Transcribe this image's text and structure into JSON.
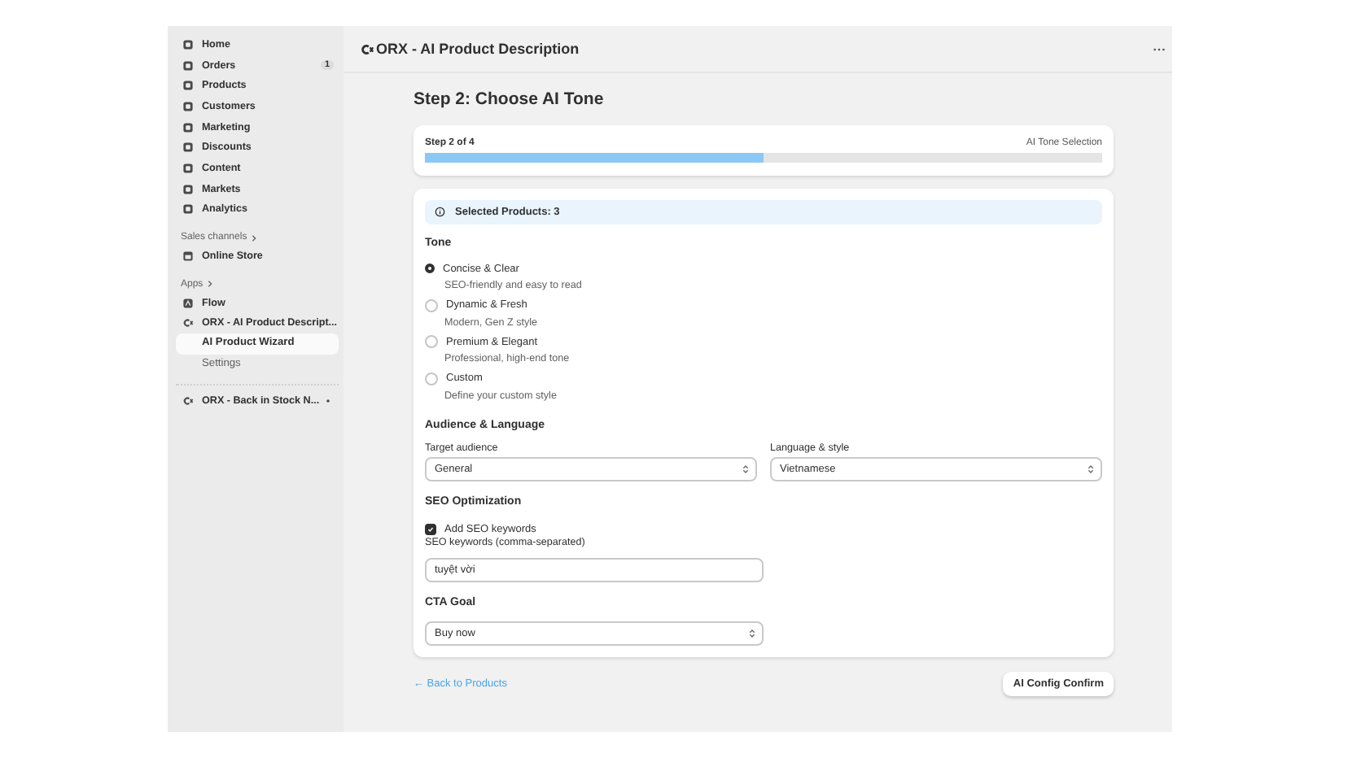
{
  "sidebar": {
    "nav": [
      {
        "label": "Home"
      },
      {
        "label": "Orders",
        "badge": "1"
      },
      {
        "label": "Products"
      },
      {
        "label": "Customers"
      },
      {
        "label": "Marketing"
      },
      {
        "label": "Discounts"
      },
      {
        "label": "Content"
      },
      {
        "label": "Markets"
      },
      {
        "label": "Analytics"
      }
    ],
    "sales_channels": {
      "heading": "Sales channels",
      "items": [
        {
          "label": "Online Store"
        }
      ]
    },
    "apps": {
      "heading": "Apps",
      "items": [
        {
          "label": "Flow"
        },
        {
          "label": "ORX - AI Product Descript...",
          "children": [
            {
              "label": "AI Product Wizard",
              "selected": true
            },
            {
              "label": "Settings",
              "selected": false
            }
          ]
        }
      ]
    },
    "pinned": [
      {
        "label": "ORX - Back in Stock N..."
      }
    ]
  },
  "header": {
    "title": "ORX - AI Product Description"
  },
  "page": {
    "heading": "Step 2: Choose AI Tone",
    "progress": {
      "step": "Step 2 of 4",
      "label": "AI Tone Selection",
      "level": 0.5
    },
    "banner": "Selected Products: 3",
    "tone": {
      "heading": "Tone",
      "options": [
        {
          "label": "Concise & Clear",
          "description": "SEO-friendly and easy to read",
          "selected": true
        },
        {
          "label": "Dynamic & Fresh",
          "description": "Modern, Gen Z style",
          "selected": false
        },
        {
          "label": "Premium & Elegant",
          "description": "Professional, high-end tone",
          "selected": false
        },
        {
          "label": "Custom",
          "description": "Define your custom style",
          "selected": false
        }
      ]
    },
    "audience": {
      "heading": "Audience & Language",
      "fields": [
        {
          "label": "Target audience",
          "value": "General"
        },
        {
          "label": "Language & style",
          "value": "Vietnamese"
        }
      ]
    },
    "seo": {
      "heading": "SEO Optimization",
      "checkbox": {
        "label": "Add SEO keywords",
        "checked": true
      },
      "keywords": {
        "label": "SEO keywords (comma-separated)",
        "value": "tuyệt vời"
      }
    },
    "cta": {
      "heading": "CTA Goal",
      "value": "Buy now"
    },
    "back_link": "← Back to Products",
    "confirm_button": "AI Config Confirm"
  }
}
